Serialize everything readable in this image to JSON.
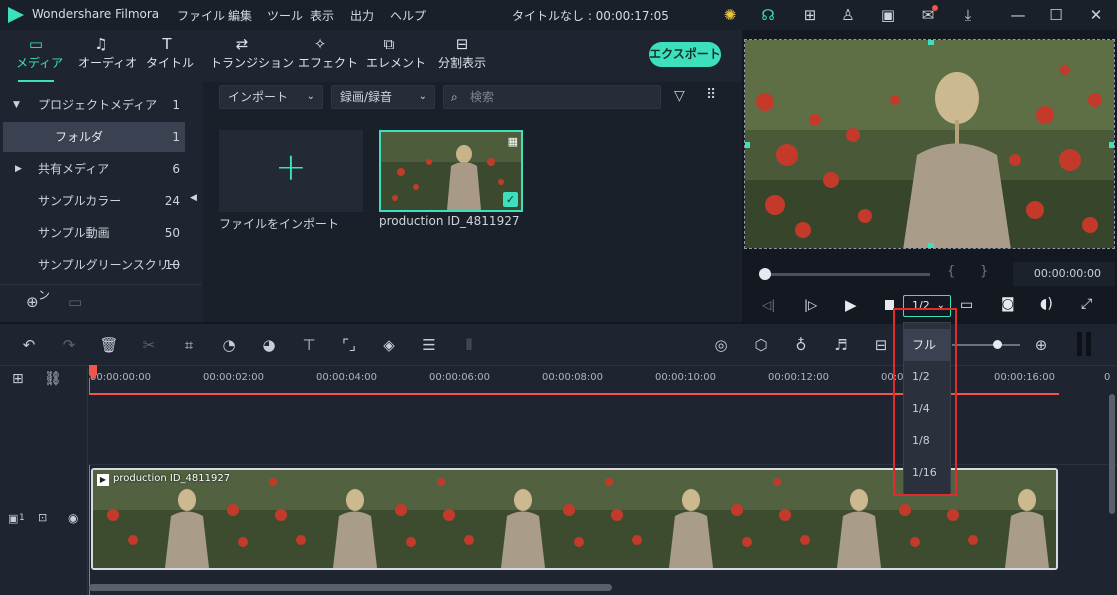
{
  "app": {
    "name": "Wondershare Filmora",
    "doc_title": "タイトルなし : 00:00:17:05"
  },
  "menu": [
    "ファイル",
    "編集",
    "ツール",
    "表示",
    "出力",
    "ヘルプ"
  ],
  "toolbar": {
    "tabs": [
      {
        "label": "メディア",
        "icon": "folder-icon"
      },
      {
        "label": "オーディオ",
        "icon": "music-note-icon"
      },
      {
        "label": "タイトル",
        "icon": "text-T-icon"
      },
      {
        "label": "トランジション",
        "icon": "transition-icon"
      },
      {
        "label": "エフェクト",
        "icon": "effects-icon"
      },
      {
        "label": "エレメント",
        "icon": "elements-icon"
      },
      {
        "label": "分割表示",
        "icon": "split-screen-icon"
      }
    ],
    "export_label": "エクスポート"
  },
  "sidebar": {
    "items": [
      {
        "label": "プロジェクトメディア",
        "count": "1"
      },
      {
        "label": "フォルダ",
        "count": "1"
      },
      {
        "label": "共有メディア",
        "count": "6"
      },
      {
        "label": "サンプルカラー",
        "count": "24"
      },
      {
        "label": "サンプル動画",
        "count": "50"
      },
      {
        "label": "サンプルグリーンスクリーン",
        "count": "10"
      }
    ]
  },
  "media": {
    "import_dropdown": "インポート",
    "record_dropdown": "録画/録音",
    "search_placeholder": "検索",
    "import_tile_label": "ファイルをインポート",
    "clip_name": "production ID_4811927"
  },
  "preview": {
    "timecode": "00:00:00:00",
    "bracket_in": "{",
    "bracket_out": "}",
    "quality": "1/2"
  },
  "quality_menu": {
    "options": [
      "フル",
      "1/2",
      "1/4",
      "1/8",
      "1/16"
    ],
    "selected": "フル"
  },
  "timeline": {
    "ticks": [
      "00:00:00:00",
      "00:00:02:00",
      "00:00:04:00",
      "00:00:06:00",
      "00:00:08:00",
      "00:00:10:00",
      "00:00:12:00",
      "00:00:1",
      "00:00:16:00"
    ],
    "clip_label": "production ID_4811927",
    "track_number": "1"
  },
  "colors": {
    "accent": "#3de0bd",
    "playhead": "#f0564a",
    "highlight_box": "#e22c2c"
  }
}
